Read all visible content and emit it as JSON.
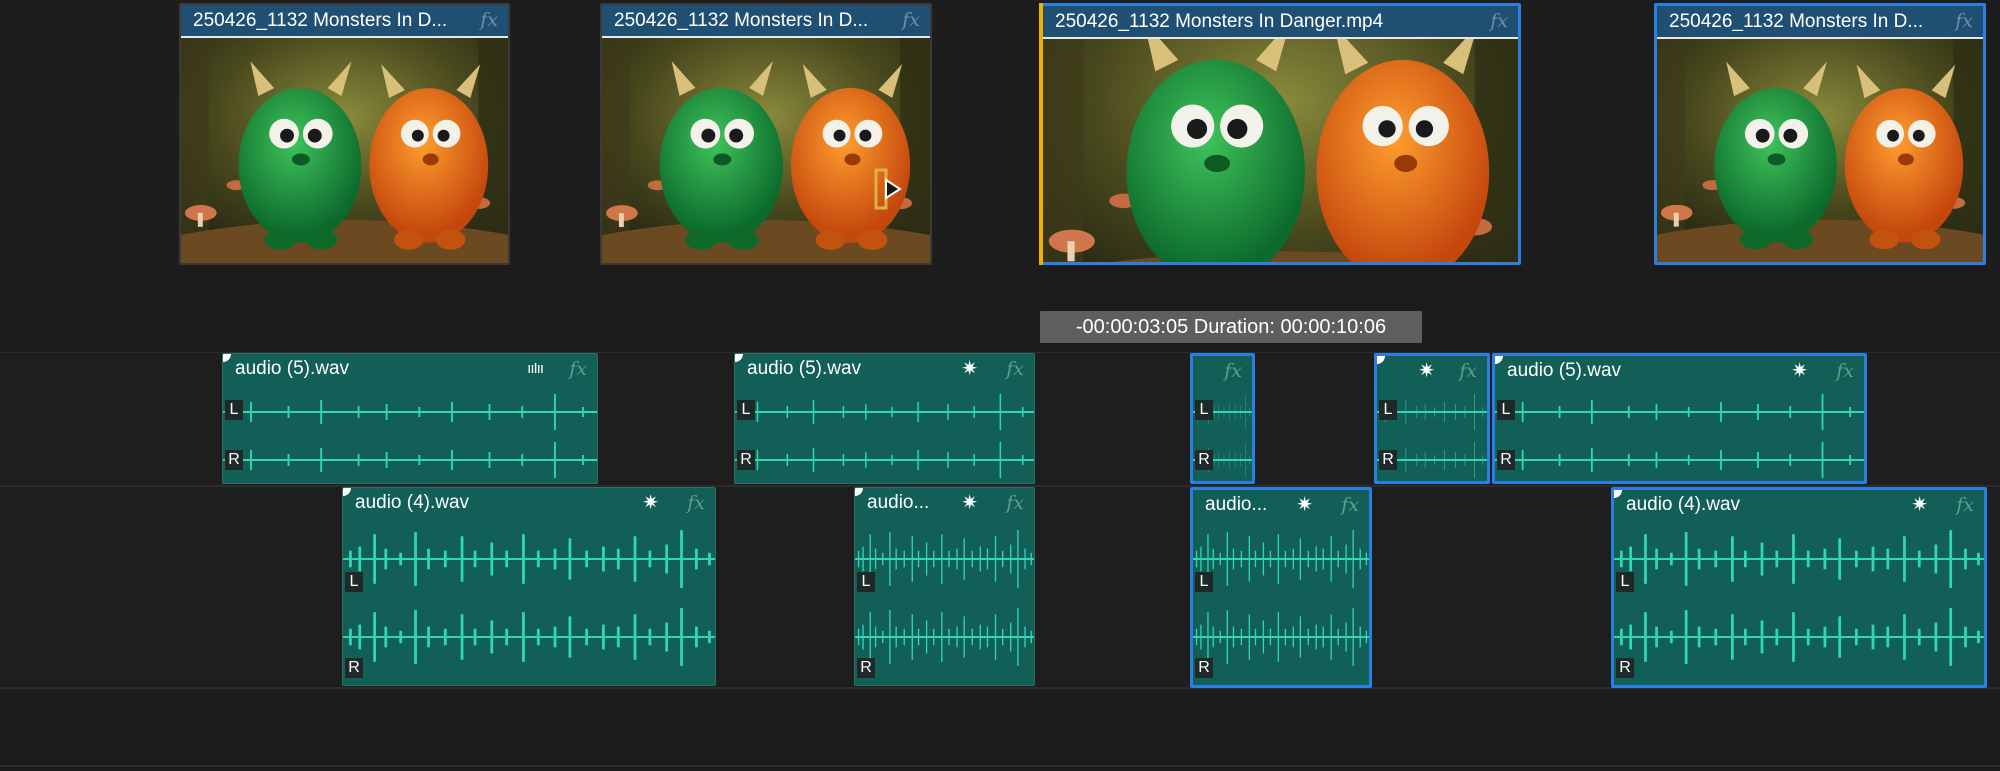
{
  "timeline": {
    "tooltip": "-00:00:03:05 Duration: 00:00:10:06",
    "fx_label": "fx",
    "video_clips": [
      {
        "label": "250426_1132 Monsters In D...",
        "selected": false
      },
      {
        "label": "250426_1132 Monsters In D...",
        "selected": false
      },
      {
        "label": "250426_1132 Monsters In Danger.mp4",
        "selected": true
      },
      {
        "label": "250426_1132 Monsters In D...",
        "selected": true
      }
    ],
    "audio_track_1_clips": [
      {
        "label": "audio (5).wav",
        "selected": false
      },
      {
        "label": "audio (5).wav",
        "selected": false
      },
      {
        "label": "",
        "selected": true
      },
      {
        "label": "",
        "selected": true
      },
      {
        "label": "audio (5).wav",
        "selected": true
      }
    ],
    "audio_track_2_clips": [
      {
        "label": "audio (4).wav",
        "selected": false
      },
      {
        "label": "audio...",
        "selected": false
      },
      {
        "label": "audio...",
        "selected": true
      },
      {
        "label": "audio (4).wav",
        "selected": true
      }
    ],
    "channels": {
      "left": "L",
      "right": "R"
    }
  },
  "colors": {
    "video_header": "#1f4f72",
    "audio_clip": "#115f56",
    "selection": "#2b7fe3",
    "playhead": "#f0b000",
    "waveform": "#2fd6b8"
  },
  "icons": [
    "fx-icon",
    "effect-star-icon",
    "audio-meter-icon",
    "ripple-edit-cursor-icon"
  ]
}
